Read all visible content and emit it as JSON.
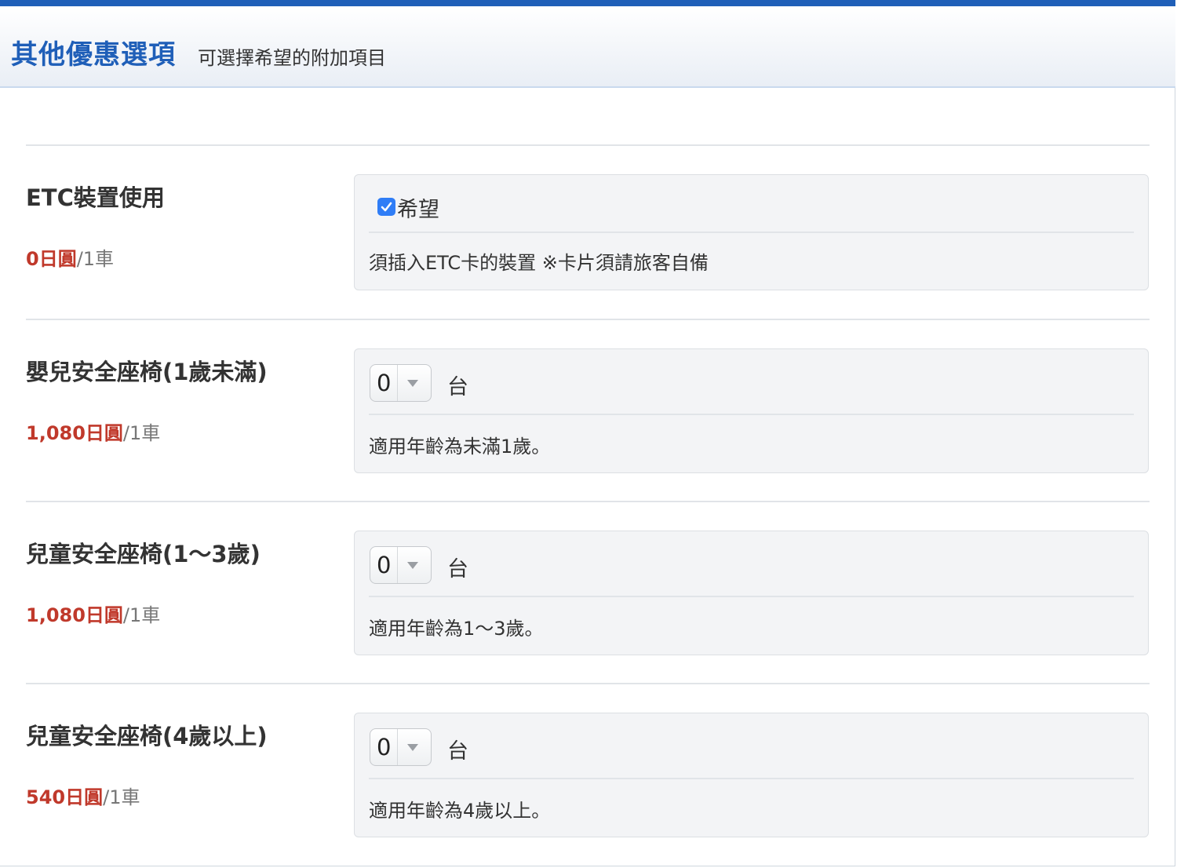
{
  "header": {
    "title": "其他優惠選項",
    "subtitle": "可選擇希望的附加項目"
  },
  "options": [
    {
      "name": "ETC裝置使用",
      "price": "0日圓",
      "per": "/1車",
      "checkbox_label": "希望",
      "checked": true,
      "description": "須插入ETC卡的裝置 ※卡片須請旅客自備"
    },
    {
      "name": "嬰兒安全座椅(1歲未滿)",
      "price": "1,080日圓",
      "per": "/1車",
      "quantity": "0",
      "unit": "台",
      "description": "適用年齡為未滿1歲。"
    },
    {
      "name": "兒童安全座椅(1～3歲)",
      "price": "1,080日圓",
      "per": "/1車",
      "quantity": "0",
      "unit": "台",
      "description": "適用年齡為1～3歲。"
    },
    {
      "name": "兒童安全座椅(4歲以上)",
      "price": "540日圓",
      "per": "/1車",
      "quantity": "0",
      "unit": "台",
      "description": "適用年齡為4歲以上。"
    }
  ],
  "colors": {
    "accent": "#1f5fb8",
    "price": "#c0392b",
    "checkbox": "#2f7df6"
  }
}
